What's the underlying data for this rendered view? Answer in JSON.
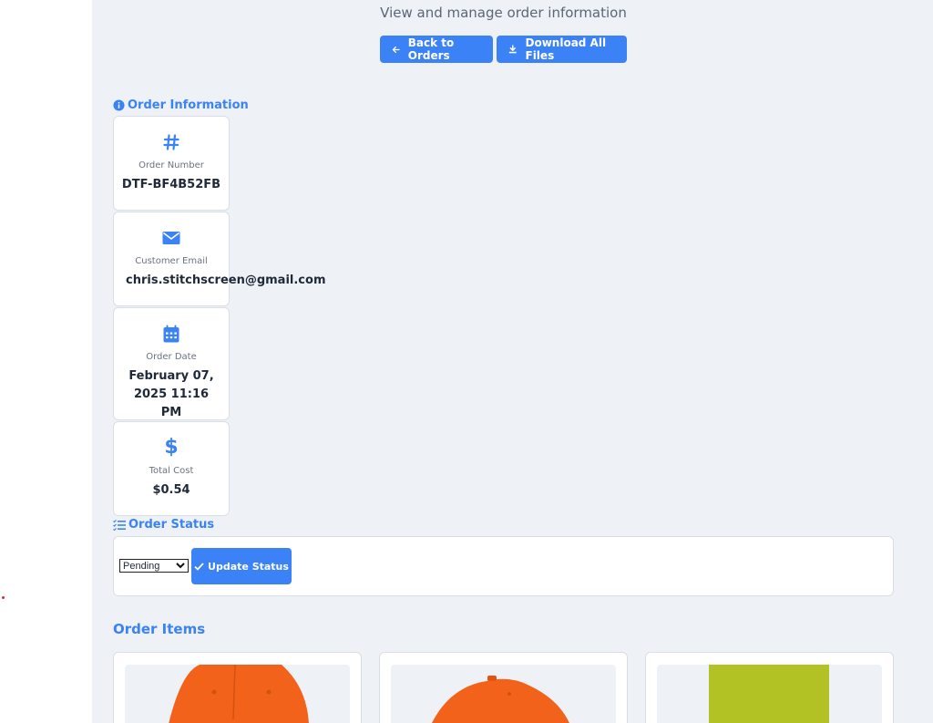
{
  "header": {
    "subtitle": "View and manage order information",
    "back_label": "Back to Orders",
    "download_label": "Download All Files"
  },
  "order_info": {
    "title": "Order Information",
    "cards": [
      {
        "icon": "hash-icon",
        "label": "Order Number",
        "value": "DTF-BF4B52FB"
      },
      {
        "icon": "envelope-icon",
        "label": "Customer Email",
        "value": "chris.stitchscreen@gmail.com"
      },
      {
        "icon": "calendar-icon",
        "label": "Order Date",
        "value": "February 07, 2025 11:16 PM"
      },
      {
        "icon": "dollar-icon",
        "label": "Total Cost",
        "value": "$0.54"
      }
    ]
  },
  "order_status": {
    "title": "Order Status",
    "selected": "Pending",
    "update_label": "Update Status"
  },
  "order_items": {
    "title": "Order Items",
    "items": [
      {
        "image": "orange-cap",
        "color": "#f2621a"
      },
      {
        "image": "orange-cap-side",
        "color": "#f2621a"
      },
      {
        "image": "lime-fabric",
        "color": "#b2c224"
      }
    ]
  },
  "colors": {
    "accent": "#3b82f6",
    "background": "#eef2f7"
  }
}
